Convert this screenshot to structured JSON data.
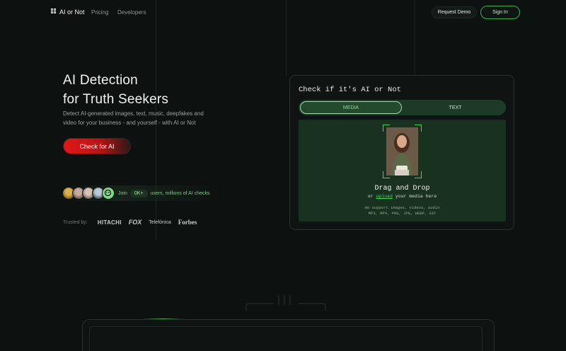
{
  "nav": {
    "logo_text": "AI or Not",
    "links": [
      "Pricing",
      "Developers"
    ],
    "request_demo": "Request Demo",
    "sign_in": "Sign In"
  },
  "hero": {
    "title_line1": "AI Detection",
    "title_line2": "for Truth Seekers",
    "subtitle": "Detect AI-generated images, text, music, deepfakes and video for your business - and yourself - with AI or Not",
    "cta": "Check for AI"
  },
  "social_proof": {
    "join": "Join",
    "badge": "0K+",
    "users": "users, millions of AI checks"
  },
  "trusted": {
    "label": "Trusted by:",
    "brands": [
      "HITACHI",
      "FOX",
      "Telefónica",
      "Forbes"
    ]
  },
  "checker": {
    "title": "Check if it's AI or Not",
    "tabs": [
      "MEDIA",
      "TEXT"
    ],
    "active_tab": "MEDIA",
    "drop_title": "Drag and Drop",
    "drop_sub_prefix": "or ",
    "drop_sub_link": "upload",
    "drop_sub_suffix": " your media here",
    "support_line1": "We support images, videos, audio",
    "support_line2": "MP3, MP4, PNG, JPG, WEBP, GIF"
  },
  "colors": {
    "accent_green": "#4fd161",
    "cta_red": "#e01818",
    "background": "#0d1110"
  }
}
